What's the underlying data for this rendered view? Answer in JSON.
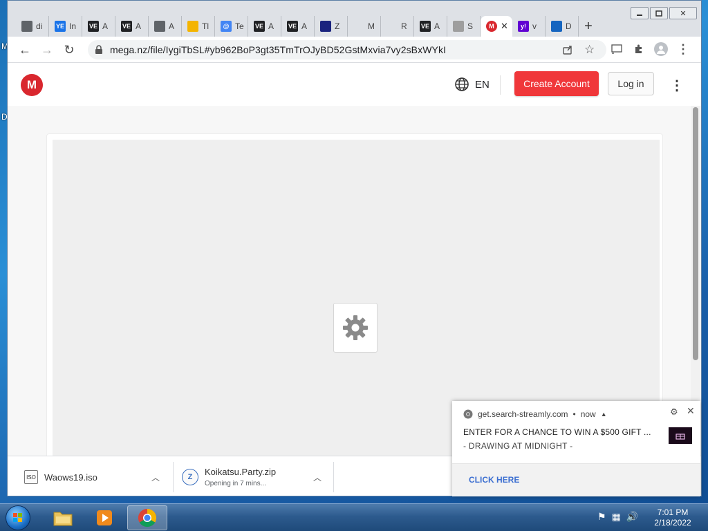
{
  "desktop": {
    "letters": [
      "M",
      "D"
    ]
  },
  "browser": {
    "window_controls": {
      "minimize": "▭",
      "maximize": "□",
      "close": "✕"
    },
    "tabs": [
      {
        "favicon_text": "",
        "favicon_color": "#5f6368",
        "label": "di",
        "icon": "globe-icon"
      },
      {
        "favicon_text": "YE",
        "favicon_color": "#1a73e8",
        "label": "In",
        "icon": "ye-icon"
      },
      {
        "favicon_text": "VE",
        "favicon_color": "#202124",
        "label": "A",
        "icon": "ve-icon"
      },
      {
        "favicon_text": "VE",
        "favicon_color": "#202124",
        "label": "A",
        "icon": "ve-icon"
      },
      {
        "favicon_text": "",
        "favicon_color": "#5f6368",
        "label": "A",
        "icon": "globe-icon"
      },
      {
        "favicon_text": "",
        "favicon_color": "#f4b400",
        "label": "Tl",
        "icon": "duck-icon"
      },
      {
        "favicon_text": "@",
        "favicon_color": "#4285f4",
        "label": "Te",
        "icon": "at-icon"
      },
      {
        "favicon_text": "VE",
        "favicon_color": "#202124",
        "label": "A",
        "icon": "ve-icon"
      },
      {
        "favicon_text": "VE",
        "favicon_color": "#202124",
        "label": "A",
        "icon": "ve-icon"
      },
      {
        "favicon_text": "",
        "favicon_color": "#1a237e",
        "label": "Z",
        "icon": "envelope-icon"
      },
      {
        "favicon_text": "",
        "favicon_color": "#dee1e6",
        "label": "M",
        "icon": "blank-icon"
      },
      {
        "favicon_text": "",
        "favicon_color": "#dee1e6",
        "label": "R",
        "icon": "blank-icon"
      },
      {
        "favicon_text": "VE",
        "favicon_color": "#202124",
        "label": "A",
        "icon": "ve-icon"
      },
      {
        "favicon_text": "",
        "favicon_color": "#9e9e9e",
        "label": "S",
        "icon": "site-icon"
      }
    ],
    "active_tab": {
      "favicon_text": "M",
      "favicon_color": "#d9272e",
      "close": "✕"
    },
    "tabs_after": [
      {
        "favicon_text": "y!",
        "favicon_color": "#6001d2",
        "label": "v",
        "icon": "yahoo-icon"
      },
      {
        "favicon_text": "",
        "favicon_color": "#1565c0",
        "label": "D",
        "icon": "chart-icon"
      }
    ],
    "new_tab": "+",
    "nav": {
      "back": "←",
      "forward": "→",
      "reload": "↻"
    },
    "url": "mega.nz/file/IygiTbSL#yb962BoP3gt35TmTrOJyBD52GstMxvia7vy2sBxWYkI"
  },
  "mega": {
    "logo": "M",
    "language": "EN",
    "create_account": "Create Account",
    "login": "Log in",
    "menu": "⋮"
  },
  "downloads": [
    {
      "name": "Waows19.iso",
      "icon_text": "ISO",
      "status": ""
    },
    {
      "name": "Koikatsu.Party.zip",
      "icon_text": "Z",
      "status": "Opening in 7 mins..."
    }
  ],
  "notification": {
    "source": "get.search-streamly.com",
    "time": "now",
    "title": "ENTER FOR A CHANCE TO WIN A $500 GIFT ...",
    "body": "- DRAWING AT MIDNIGHT -",
    "action": "CLICK HERE"
  },
  "taskbar": {
    "clock_time": "7:01 PM",
    "clock_date": "2/18/2022"
  }
}
